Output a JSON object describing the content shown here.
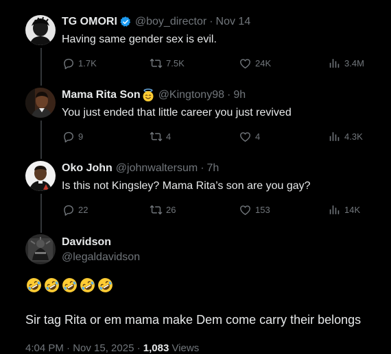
{
  "replies": [
    {
      "display_name": "TG OMORI",
      "verified": true,
      "handle": "@boy_director",
      "separator": "·",
      "time": "Nov 14",
      "text": "Having same gender sex is evil.",
      "stats": {
        "replies": "1.7K",
        "reposts": "7.5K",
        "likes": "24K",
        "views": "3.4M"
      }
    },
    {
      "display_name": "Mama Rita Son",
      "emoji": "smiling-face-with-halo",
      "handle": "@Kingtony98",
      "separator": "·",
      "time": "9h",
      "text": "You just ended that little career you just revived",
      "stats": {
        "replies": "9",
        "reposts": "4",
        "likes": "4",
        "views": "4.3K"
      }
    },
    {
      "display_name": "Oko John",
      "handle": "@johnwaltersum",
      "separator": "·",
      "time": "7h",
      "text": "Is this not Kingsley? Mama Rita’s son are you gay?",
      "stats": {
        "replies": "22",
        "reposts": "26",
        "likes": "153",
        "views": "14K"
      }
    }
  ],
  "main_tweet": {
    "display_name": "Davidson",
    "handle": "@legaldavidson",
    "emoji_line": [
      "rolling-on-floor-laughing",
      "rolling-on-floor-laughing",
      "rolling-on-floor-laughing",
      "rolling-on-floor-laughing",
      "rolling-on-floor-laughing"
    ],
    "text": "Sir tag Rita or em mama make Dem come carry their belongs",
    "timestamp": "4:04 PM · Nov 15, 2025 ·",
    "views_count": "1,083",
    "views_label": "Views"
  },
  "colors": {
    "background": "#000000",
    "text_primary": "#e7e9ea",
    "text_secondary": "#71767b",
    "verified_blue": "#1d9bf0",
    "thread_line": "#333639"
  }
}
